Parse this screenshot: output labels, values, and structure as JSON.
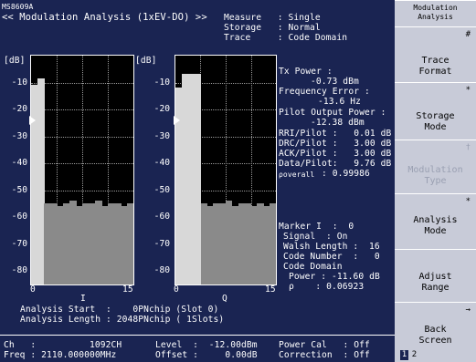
{
  "header": {
    "model": "MS8609A",
    "title": "<< Modulation Analysis (1xEV-DO) >>",
    "measure": "Measure   : Single",
    "storage": "Storage   : Normal",
    "trace": "Trace     : Code Domain"
  },
  "graph1": {
    "unit": "[dB]",
    "y_ticks": [
      "-10",
      "-20",
      "-30",
      "-40",
      "-50",
      "-60",
      "-70",
      "-80"
    ],
    "x_start": "0",
    "x_end": "15",
    "x_mid": "I"
  },
  "graph2": {
    "unit": "[dB]",
    "y_ticks": [
      "-10",
      "-20",
      "-30",
      "-40",
      "-50",
      "-60",
      "-70",
      "-80"
    ],
    "x_start": "0",
    "x_end": "15",
    "x_mid": "Q"
  },
  "chart_data": [
    {
      "type": "bar",
      "title": "",
      "ylabel": "[dB]",
      "ylim": [
        -85,
        0
      ],
      "x": [
        "0",
        "1",
        "2",
        "3",
        "4",
        "5",
        "6",
        "7",
        "8",
        "9",
        "10",
        "11",
        "12",
        "13",
        "14",
        "15"
      ],
      "series": [
        {
          "values": [
            -11,
            -8.5,
            -55,
            -55,
            -56,
            -55,
            -54,
            -56,
            -55,
            -55,
            -54,
            -56,
            -55,
            -55,
            -56,
            -55
          ]
        }
      ]
    },
    {
      "type": "bar",
      "title": "",
      "ylabel": "[dB]",
      "ylim": [
        -85,
        0
      ],
      "x": [
        "0",
        "1",
        "2",
        "3",
        "4",
        "5",
        "6",
        "7",
        "8",
        "9",
        "10",
        "11",
        "12",
        "13",
        "14",
        "15"
      ],
      "series": [
        {
          "values": [
            -12,
            -6.8,
            -6.8,
            -6.8,
            -55,
            -56,
            -55,
            -55,
            -54,
            -56,
            -55,
            -55,
            -56,
            -55,
            -56,
            -55
          ]
        }
      ]
    }
  ],
  "results": {
    "tx_power_label": "Tx Power :",
    "tx_power_value": "-0.73 dBm",
    "freq_error_label": "Frequency Error :",
    "freq_error_value": "-13.6 Hz",
    "pilot_power_label": "Pilot Output Power :",
    "pilot_power_value": "-12.38 dBm",
    "rri": "RRI/Pilot :   0.01 dB",
    "drc": "DRC/Pilot :   3.00 dB",
    "ack": "ACK/Pilot :   3.00 dB",
    "data": "Data/Pilot:   9.76 dB",
    "rho_overall_label": "ρoverall",
    "rho_overall_value": ": 0.99986"
  },
  "marker": {
    "title": "Marker I  :  0",
    "signal": "Signal  : On",
    "walsh": "Walsh Length :  16",
    "code_number": "Code Number  :   0",
    "code_domain": "Code Domain",
    "power": "Power : -11.60 dB",
    "rho": "ρ    : 0.06923"
  },
  "analysis": {
    "start": "Analysis Start  :    0PNchip (Slot 0)",
    "length": "Analysis Length : 2048PNchip ( 1Slots)"
  },
  "status": {
    "ch": "Ch   :          1092CH",
    "freq": "Freq : 2110.000000MHz",
    "level": "Level  :  -12.00dBm",
    "offset": "Offset :     0.00dB",
    "power_cal": "Power Cal   : Off",
    "correction": "Correction  : Off"
  },
  "softkeys": {
    "menu_title_1": "Modulation",
    "menu_title_2": "Analysis",
    "k1_line1": "Trace",
    "k1_line2": "Format",
    "k1_ind": "#",
    "k2_line1": "Storage",
    "k2_line2": "Mode",
    "k2_ind": "*",
    "k3_line1": "Modulation",
    "k3_line2": "Type",
    "k3_ind": "†",
    "k4_line1": "Analysis",
    "k4_line2": "Mode",
    "k4_ind": "*",
    "k5_line1": "Adjust",
    "k5_line2": "Range",
    "k6_line1": "Back",
    "k6_line2": "Screen",
    "k6_ind": "→",
    "page_1": "1",
    "page_2": "2"
  }
}
